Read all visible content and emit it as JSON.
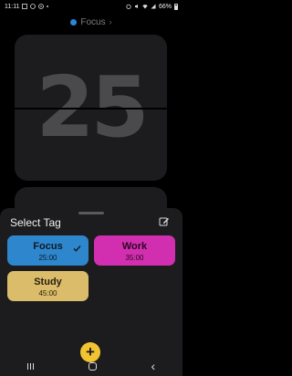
{
  "status_bar": {
    "time": "11:11",
    "battery": "66%"
  },
  "header": {
    "current_tag": "Focus",
    "chevron": "›"
  },
  "timer": {
    "digits": "25"
  },
  "sheet": {
    "title": "Select Tag",
    "tags": [
      {
        "name": "Focus",
        "duration": "25:00",
        "color": "#2e86cd",
        "selected": true
      },
      {
        "name": "Work",
        "duration": "35:00",
        "color": "#d22fb0",
        "selected": false
      },
      {
        "name": "Study",
        "duration": "45:00",
        "color": "#dbbc6a",
        "selected": false
      }
    ]
  },
  "fab": {
    "label": "+"
  },
  "icons": {
    "edit": "edit-icon",
    "check": "checkmark-icon",
    "back": "back-icon"
  },
  "nav": {
    "back": "‹"
  },
  "colors": {
    "background": "#000000",
    "card": "#1c1c1e",
    "accent": "#f2c431"
  }
}
